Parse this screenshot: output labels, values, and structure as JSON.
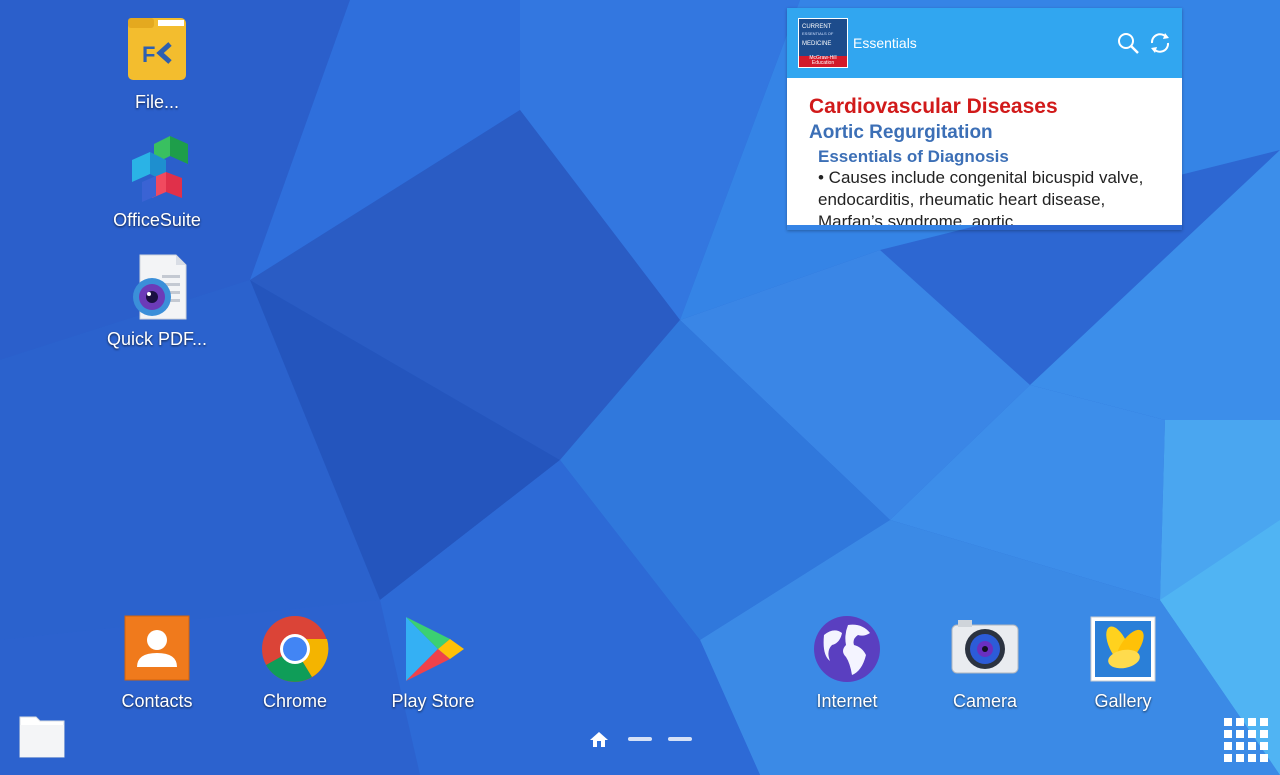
{
  "desktop_apps": [
    {
      "label": "File...",
      "icon": "file-commander-icon"
    },
    {
      "label": "OfficeSuite",
      "icon": "officesuite-icon"
    },
    {
      "label": "Quick PDF...",
      "icon": "quick-pdf-icon"
    }
  ],
  "widget": {
    "logo_line1": "CURRENT",
    "logo_line2": "ESSENTIALS OF",
    "logo_line3": "MEDICINE",
    "logo_brand": "McGraw-Hill Education",
    "title": "Essentials",
    "heading": "Cardiovascular Diseases",
    "subheading": "Aortic Regurgitation",
    "section": "Essentials of Diagnosis",
    "text": "• Causes include congenital bicuspid valve, endocarditis, rheumatic heart disease, Marfan’s syndrome, aortic",
    "search_icon": "search-icon",
    "refresh_icon": "refresh-icon"
  },
  "dock": [
    {
      "label": "Contacts",
      "icon": "contacts-icon"
    },
    {
      "label": "Chrome",
      "icon": "chrome-icon"
    },
    {
      "label": "Play Store",
      "icon": "play-store-icon"
    },
    {
      "label": "Internet",
      "icon": "internet-icon"
    },
    {
      "label": "Camera",
      "icon": "camera-icon"
    },
    {
      "label": "Gallery",
      "icon": "gallery-icon"
    }
  ],
  "colors": {
    "wallpaper": "#2f6fd8",
    "widget_header": "#31a6f0",
    "heading_red": "#d11a1a",
    "subheading_blue": "#3c6fb6"
  }
}
